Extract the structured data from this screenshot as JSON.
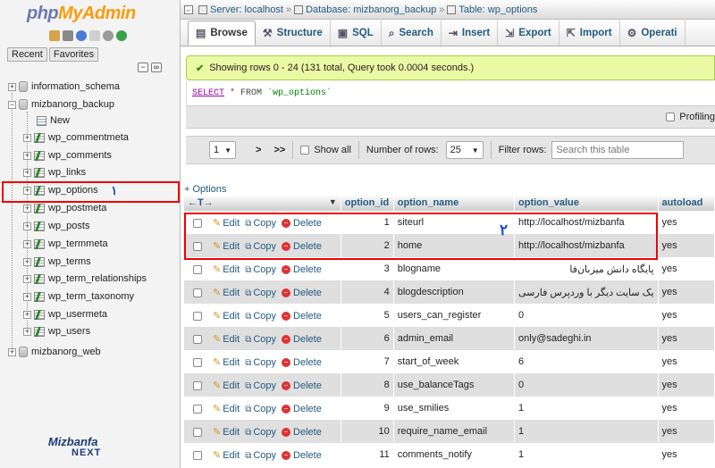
{
  "sidebar": {
    "logo_php": "php",
    "logo_myadmin": "MyAdmin",
    "recent_tab": "Recent",
    "favorites_tab": "Favorites",
    "databases": [
      {
        "name": "information_schema"
      },
      {
        "name": "mizbanorg_backup"
      },
      {
        "name": "mizbanorg_web"
      }
    ],
    "new_label": "New",
    "tables": [
      "wp_commentmeta",
      "wp_comments",
      "wp_links",
      "wp_options",
      "wp_postmeta",
      "wp_posts",
      "wp_termmeta",
      "wp_terms",
      "wp_term_relationships",
      "wp_term_taxonomy",
      "wp_usermeta",
      "wp_users"
    ],
    "annotation_1": "۱",
    "brand_line1": "Mizbanfa",
    "brand_line2": "NEXT"
  },
  "breadcrumb": {
    "server": "Server: localhost",
    "database": "Database: mizbanorg_backup",
    "table": "Table: wp_options",
    "sep": "»"
  },
  "tabs": [
    {
      "label": "Browse",
      "icon": "▤"
    },
    {
      "label": "Structure",
      "icon": "⚒"
    },
    {
      "label": "SQL",
      "icon": "▣"
    },
    {
      "label": "Search",
      "icon": "⌕"
    },
    {
      "label": "Insert",
      "icon": "⇥"
    },
    {
      "label": "Export",
      "icon": "⇲"
    },
    {
      "label": "Import",
      "icon": "⇱"
    },
    {
      "label": "Operati",
      "icon": "⚙"
    }
  ],
  "message": {
    "text": "Showing rows 0 - 24 (131 total, Query took 0.0004 seconds.)"
  },
  "sql": {
    "select": "SELECT",
    "rest": " * FROM ",
    "table": "`wp_options`"
  },
  "profiling_label": "Profiling",
  "navigation": {
    "page": "1",
    "next": ">",
    "last": ">>",
    "show_all": "Show all",
    "rows_label": "Number of rows:",
    "rows_value": "25",
    "filter_label": "Filter rows:",
    "filter_placeholder": "Search this table"
  },
  "options_link": "+ Options",
  "table": {
    "headers": [
      "option_id",
      "option_name",
      "option_value",
      "autoload"
    ],
    "arrows": "←T→",
    "actions": {
      "edit": "Edit",
      "copy": "Copy",
      "delete": "Delete"
    },
    "rows": [
      {
        "id": "1",
        "name": "siteurl",
        "value": "http://localhost/mizbanfa",
        "autoload": "yes",
        "rtl": false
      },
      {
        "id": "2",
        "name": "home",
        "value": "http://localhost/mizbanfa",
        "autoload": "yes",
        "rtl": false
      },
      {
        "id": "3",
        "name": "blogname",
        "value": "پایگاه دانش میزبان‌فا",
        "autoload": "yes",
        "rtl": true
      },
      {
        "id": "4",
        "name": "blogdescription",
        "value": "یک سایت دیگر با وردپرس فارسی",
        "autoload": "yes",
        "rtl": true
      },
      {
        "id": "5",
        "name": "users_can_register",
        "value": "0",
        "autoload": "yes",
        "rtl": false
      },
      {
        "id": "6",
        "name": "admin_email",
        "value": "only@sadeghi.in",
        "autoload": "yes",
        "rtl": false
      },
      {
        "id": "7",
        "name": "start_of_week",
        "value": "6",
        "autoload": "yes",
        "rtl": false
      },
      {
        "id": "8",
        "name": "use_balanceTags",
        "value": "0",
        "autoload": "yes",
        "rtl": false
      },
      {
        "id": "9",
        "name": "use_smilies",
        "value": "1",
        "autoload": "yes",
        "rtl": false
      },
      {
        "id": "10",
        "name": "require_name_email",
        "value": "1",
        "autoload": "yes",
        "rtl": false
      },
      {
        "id": "11",
        "name": "comments_notify",
        "value": "1",
        "autoload": "yes",
        "rtl": false
      }
    ]
  },
  "annotation_2": "۲"
}
